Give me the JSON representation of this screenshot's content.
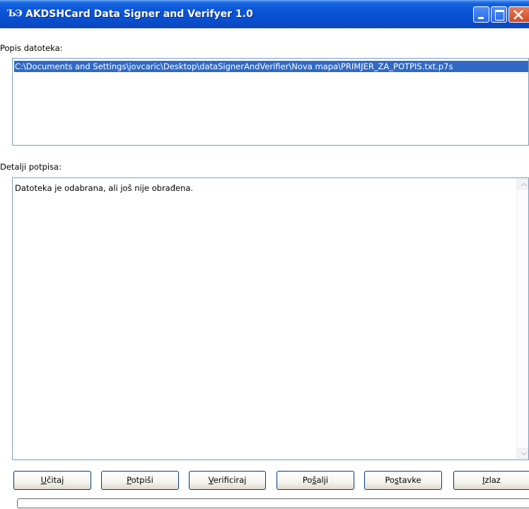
{
  "window": {
    "icon_text": "ЪЭ",
    "title": "AKDSHCard Data Signer and Verifyer 1.0"
  },
  "files_section": {
    "label": "Popis datoteka:",
    "items": [
      "C:\\Documents and Settings\\jovcaric\\Desktop\\dataSignerAndVerifier\\Nova mapa\\PRIMJER_ZA_POTPIS.txt.p7s"
    ],
    "selected_index": 0
  },
  "details_section": {
    "label": "Detalji potpisa:",
    "text": "Datoteka je odabrana, ali još nije obrađena."
  },
  "buttons": {
    "load": {
      "before": "",
      "mnemonic": "U",
      "after": "čitaj"
    },
    "sign": {
      "before": "",
      "mnemonic": "P",
      "after": "otpiši"
    },
    "verify": {
      "before": "",
      "mnemonic": "V",
      "after": "erificiraj"
    },
    "send": {
      "before": "Po",
      "mnemonic": "š",
      "after": "alji"
    },
    "settings": {
      "before": "Po",
      "mnemonic": "s",
      "after": "tavke"
    },
    "exit": {
      "before": "",
      "mnemonic": "I",
      "after": "zlaz"
    }
  },
  "progress": {
    "value": 0
  },
  "colors": {
    "titlebar": "#0a54d6",
    "selection": "#316ac5",
    "border": "#7f9db9"
  }
}
